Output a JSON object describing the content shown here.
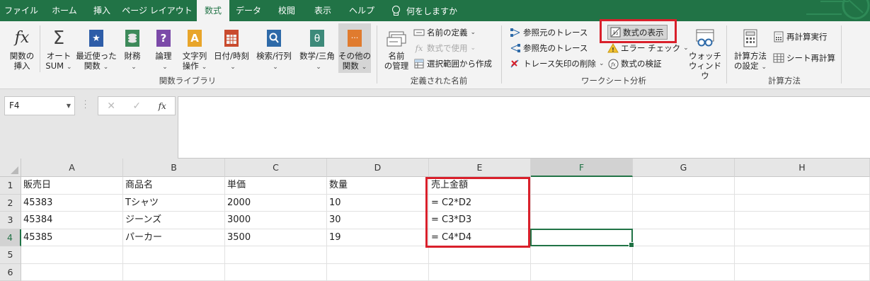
{
  "tabs": [
    "ファイル",
    "ホーム",
    "挿入",
    "ページ レイアウト",
    "数式",
    "データ",
    "校閲",
    "表示",
    "ヘルプ"
  ],
  "active_tab_index": 4,
  "tell_me": "何をしますか",
  "ribbon": {
    "function_library": {
      "insert_function": [
        "関数の",
        "挿入"
      ],
      "autosum": [
        "オート",
        "SUM"
      ],
      "recently_used": [
        "最近使った",
        "関数"
      ],
      "financial": "財務",
      "logical": "論理",
      "text": [
        "文字列",
        "操作"
      ],
      "datetime": "日付/時刻",
      "lookup": "検索/行列",
      "math": "数学/三角",
      "more": [
        "その他の",
        "関数"
      ],
      "label": "関数ライブラリ"
    },
    "defined_names": {
      "name_manager": [
        "名前",
        "の管理"
      ],
      "define_name": "名前の定義",
      "use_in_formula": "数式で使用",
      "create_from_selection": "選択範囲から作成",
      "label": "定義された名前"
    },
    "formula_auditing": {
      "trace_precedents": "参照元のトレース",
      "trace_dependents": "参照先のトレース",
      "remove_arrows": "トレース矢印の削除",
      "show_formulas": "数式の表示",
      "error_checking": "エラー チェック",
      "evaluate_formula": "数式の検証",
      "watch_window": [
        "ウォッチ",
        "ウィンドウ"
      ],
      "label": "ワークシート分析"
    },
    "calculation": {
      "options": [
        "計算方法",
        "の設定"
      ],
      "calc_now": "再計算実行",
      "calc_sheet": "シート再計算",
      "label": "計算方法"
    }
  },
  "formula_bar": {
    "name_box": "F4",
    "formula": ""
  },
  "accent_color": "#217346",
  "highlight_color": "#d9202b",
  "sheet": {
    "columns": [
      "A",
      "B",
      "C",
      "D",
      "E",
      "F",
      "G",
      "H"
    ],
    "rows": [
      "1",
      "2",
      "3",
      "4",
      "5",
      "6"
    ],
    "selected_column": "F",
    "selected_row": "4",
    "cells": [
      [
        "販売日",
        "商品名",
        "単価",
        "数量",
        "売上金額",
        "",
        "",
        ""
      ],
      [
        "45383",
        "Tシャツ",
        "2000",
        "10",
        "= C2*D2",
        "",
        "",
        ""
      ],
      [
        "45384",
        "ジーンズ",
        "3000",
        "30",
        "= C3*D3",
        "",
        "",
        ""
      ],
      [
        "45385",
        "パーカー",
        "3500",
        "19",
        "= C4*D4",
        "",
        "",
        ""
      ],
      [
        "",
        "",
        "",
        "",
        "",
        "",
        "",
        ""
      ],
      [
        "",
        "",
        "",
        "",
        "",
        "",
        "",
        ""
      ]
    ]
  }
}
